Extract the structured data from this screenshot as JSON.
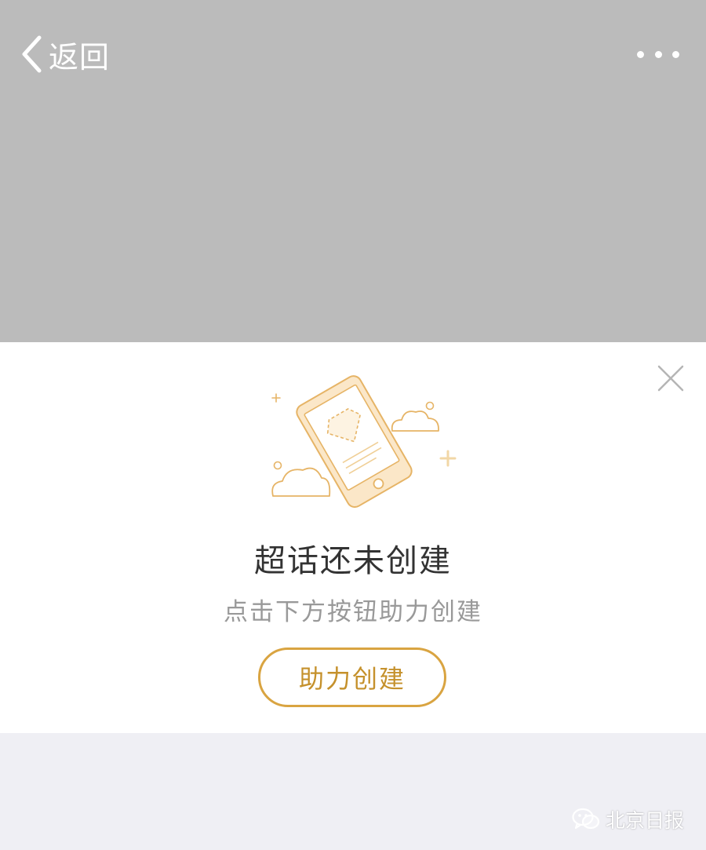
{
  "nav": {
    "back_label": "返回",
    "more_icon": "more-horizontal-icon"
  },
  "card": {
    "title": "超话还未创建",
    "subtitle": "点击下方按钮助力创建",
    "button_label": "助力创建",
    "close_icon": "close-icon",
    "illustration_icon": "phone-with-diamond-illustration"
  },
  "watermark": {
    "text": "北京日报",
    "icon": "wechat-icon"
  },
  "colors": {
    "header_bg": "#bbbbbb",
    "accent": "#d9a441",
    "page_bg": "#efeff4"
  }
}
